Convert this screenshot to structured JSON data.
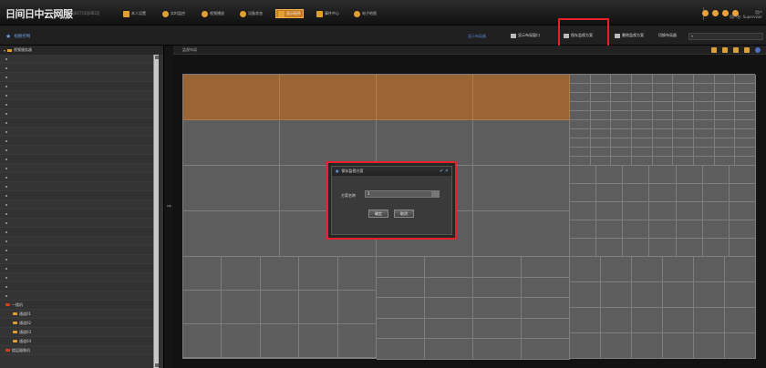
{
  "app": {
    "logo": "日间日中云网服",
    "logo_sub": "SJEDTQDJ88DZJ"
  },
  "nav": [
    {
      "label": "本人设置",
      "icon": "square-icon"
    },
    {
      "label": "实时监控",
      "icon": "circle-icon"
    },
    {
      "label": "视频播放",
      "icon": "circle-icon"
    },
    {
      "label": "设备状态",
      "icon": "circle-icon"
    },
    {
      "label": "显示拓扑",
      "icon": "square-icon",
      "active": true
    },
    {
      "label": "事件中心",
      "icon": "square-icon"
    },
    {
      "label": "电子地图",
      "icon": "circle-icon"
    }
  ],
  "user": {
    "line1": "用户",
    "line2": "用户名: Supervisor"
  },
  "toolbar": {
    "title": "视频控制",
    "link": "显示布局器",
    "btn1": "显示布局窗口",
    "btn2": "保存监视方案",
    "btn3": "删除监视方案",
    "select_label": "切换布局器"
  },
  "leftpanel": {
    "header": "视频服务器",
    "group1": "一楼机",
    "items": [
      "通道01",
      "通道02",
      "通道03",
      "通道04"
    ],
    "group2": "楼层摄像机"
  },
  "mainarea": {
    "header": "监视布局"
  },
  "dialog": {
    "title": "保存监视方案",
    "label": "方案名称",
    "value": "1",
    "ok": "确定",
    "cancel": "取消"
  },
  "colors": {
    "highlight": "#e8202a",
    "accent": "#e0a030",
    "cell_orange": "#9b6434",
    "cell_gray": "#5d5d5d"
  }
}
